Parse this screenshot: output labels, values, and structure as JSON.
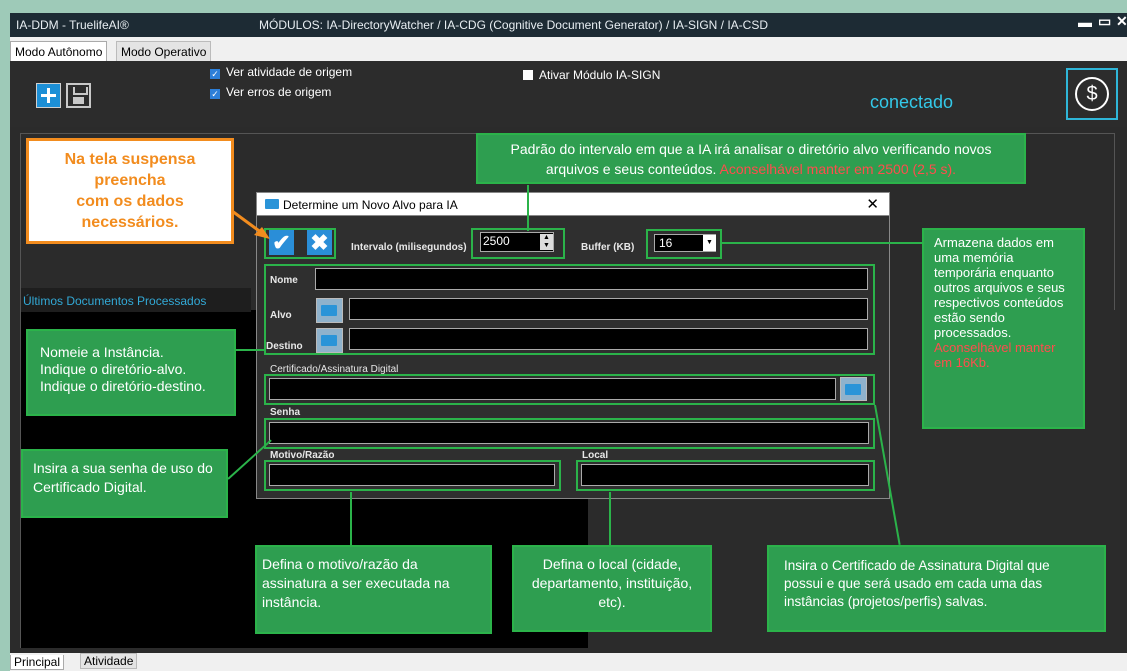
{
  "window": {
    "app_name": "IA-DDM  -  TruelifeAI®",
    "modules": "MÓDULOS:  IA-DirectoryWatcher / IA-CDG (Cognitive Document Generator) / IA-SIGN / IA-CSD"
  },
  "tabs_top": {
    "auto": "Modo Autônomo",
    "operative": "Modo Operativo"
  },
  "toolbar": {
    "check_activity": "Ver atividade de origem",
    "check_errors": "Ver erros de origem",
    "check_sign": "Ativar Módulo IA-SIGN",
    "status": "conectado",
    "dollar": "$"
  },
  "main": {
    "last_docs": "Últimos Documentos Processados"
  },
  "tabs_bottom": {
    "principal": "Principal",
    "activity": "Atividade"
  },
  "dialog": {
    "title": "Determine um Novo Alvo para IA",
    "close": "✕",
    "interval_label": "Intervalo (milisegundos)",
    "interval_value": "2500",
    "buffer_label": "Buffer (KB)",
    "buffer_value": "16",
    "nome_label": "Nome",
    "alvo_label": "Alvo",
    "destino_label": "Destino",
    "cert_label": "Certificado/Assinatura Digital",
    "senha_label": "Senha",
    "motivo_label": "Motivo/Razão",
    "local_label": "Local"
  },
  "annotations": {
    "orange": [
      "Na tela suspensa",
      "preencha",
      "com os dados",
      "necessários."
    ],
    "interval_note": "Padrão do intervalo em que a IA irá analisar o diretório alvo verificando novos arquivos e seus conteúdos.",
    "interval_note_red": "Aconselhável manter em 2500 (2,5 s).",
    "buffer_note": "Armazena dados em uma memória temporária enquanto outros arquivos e seus respectivos conteúdos estão sendo processados.",
    "buffer_note_red": "Aconselhável manter em 16Kb.",
    "name_note": [
      "Nomeie a Instância.",
      "Indique o diretório-alvo.",
      "Indique o diretório-destino."
    ],
    "pwd_note": "Insira a sua senha de uso do Certificado Digital.",
    "motivo_note": "Defina o motivo/razão da assinatura  a ser executada na instância.",
    "local_note": "Defina o local (cidade, departamento, instituição, etc).",
    "cert_note": "Insira o Certificado de Assinatura Digital que possui e que será usado em cada uma das instâncias (projetos/perfis) salvas."
  },
  "colors": {
    "accent": "#2bb34a",
    "orange": "#f28c1e",
    "status": "#33c8e8",
    "red_text": "#ff4d4d"
  }
}
